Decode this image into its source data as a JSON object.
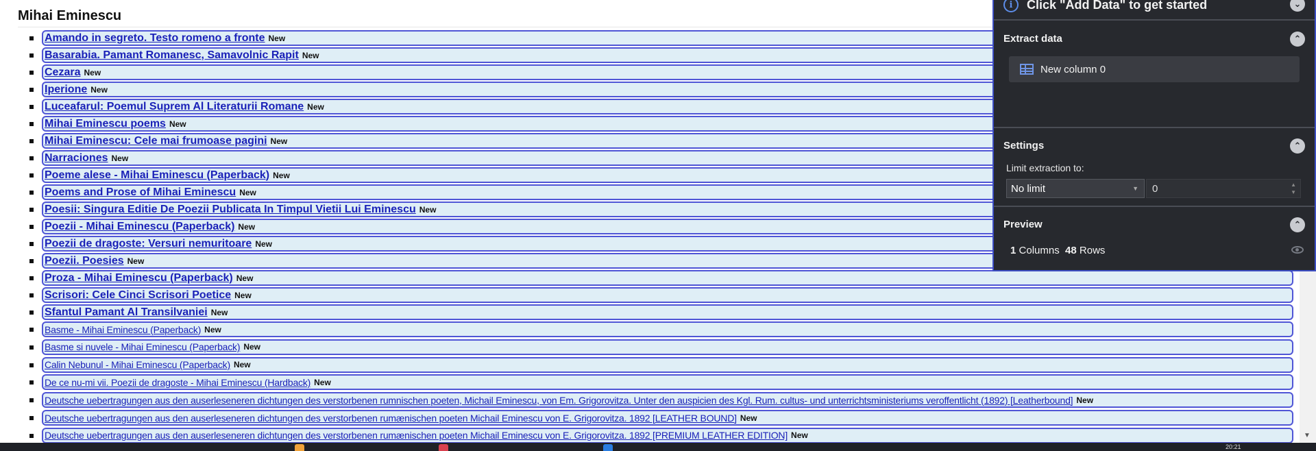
{
  "page": {
    "title": "Mihai Eminescu"
  },
  "new_label": "New",
  "books": [
    {
      "title": "Amando in segreto. Testo romeno a fronte",
      "bold": true
    },
    {
      "title": "Basarabia. Pamant Romanesc, Samavolnic Rapit",
      "bold": true
    },
    {
      "title": "Cezara",
      "bold": true
    },
    {
      "title": "Iperione",
      "bold": true
    },
    {
      "title": "Luceafarul: Poemul Suprem Al Literaturii Romane",
      "bold": true
    },
    {
      "title": "Mihai Eminescu poems",
      "bold": true
    },
    {
      "title": "Mihai Eminescu: Cele mai frumoase pagini",
      "bold": true
    },
    {
      "title": "Narraciones",
      "bold": true
    },
    {
      "title": "Poeme alese - Mihai Eminescu (Paperback)",
      "bold": true
    },
    {
      "title": "Poems and Prose of Mihai Eminescu",
      "bold": true
    },
    {
      "title": "Poesii: Singura Editie De Poezii Publicata In Timpul Vietii Lui Eminescu",
      "bold": true
    },
    {
      "title": "Poezii - Mihai Eminescu (Paperback)",
      "bold": true
    },
    {
      "title": "Poezii de dragoste: Versuri nemuritoare",
      "bold": true
    },
    {
      "title": "Poezii. Poesies",
      "bold": true
    },
    {
      "title": "Proza - Mihai Eminescu (Paperback)",
      "bold": true
    },
    {
      "title": "Scrisori: Cele Cinci Scrisori Poetice",
      "bold": true
    },
    {
      "title": "Sfantul Pamant Al Transilvaniei",
      "bold": true
    },
    {
      "title": "Basme - Mihai Eminescu (Paperback)",
      "bold": false
    },
    {
      "title": "Basme si nuvele - Mihai Eminescu (Paperback)",
      "bold": false
    },
    {
      "title": "Calin Nebunul - Mihai Eminescu (Paperback)",
      "bold": false
    },
    {
      "title": "De ce nu-mi vii. Poezii de dragoste - Mihai Eminescu (Hardback)",
      "bold": false
    },
    {
      "title": "Deutsche uebertragungen aus den auserleseneren dichtungen des verstorbenen rumnischen poeten, Michail Eminescu, von Em. Grigorovitza. Unter den auspicien des Kgl. Rum. cultus- und unterrichtsministeriums veroffentlicht (1892) [Leatherbound]",
      "bold": false
    },
    {
      "title": "Deutsche uebertragungen aus den auserleseneren dichtungen des verstorbenen rumænischen poeten Michail Eminescu von E. Grigorovitza. 1892 [LEATHER BOUND]",
      "bold": false
    },
    {
      "title": "Deutsche uebertragungen aus den auserleseneren dichtungen des verstorbenen rumænischen poeten Michail Eminescu von E. Grigorovitza. 1892 [PREMIUM LEATHER EDITION]",
      "bold": false
    }
  ],
  "panel": {
    "header": "Click \"Add Data\" to get started",
    "extract": {
      "title": "Extract data",
      "columns": [
        "New column 0"
      ]
    },
    "settings": {
      "title": "Settings",
      "limit_label": "Limit extraction to:",
      "limit_option": "No limit",
      "limit_value": "0"
    },
    "preview": {
      "title": "Preview",
      "columns": "1",
      "columns_label": "Columns",
      "rows": "48",
      "rows_label": "Rows"
    },
    "accent": "#3c4ec4"
  },
  "icons": {
    "info": "info-icon",
    "collapse": "chevron-up-icon",
    "expand": "chevron-down-icon",
    "column": "column-icon",
    "preview": "eye-icon"
  },
  "taskbar": {
    "clock": "20:21"
  }
}
